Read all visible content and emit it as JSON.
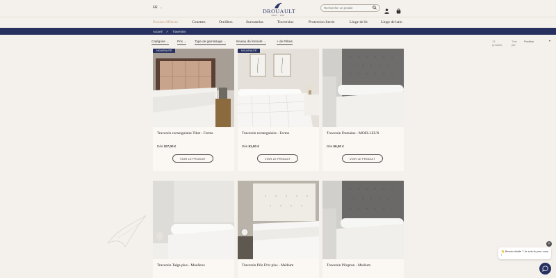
{
  "header": {
    "lang": "FR",
    "logo_name": "DROUAULT",
    "logo_tag": "PARIS · 1916",
    "search_placeholder": "Rechercher un produit"
  },
  "nav": {
    "items": [
      "Bonnes Affaires",
      "Couettes",
      "Oreillers",
      "Surmatelas",
      "Traversins",
      "Protection literie",
      "Linge de lit",
      "Linge de bain"
    ]
  },
  "breadcrumb": {
    "home": "Accueil",
    "sep": ">",
    "current": "Traversins"
  },
  "filters": {
    "items": [
      "Catégorie",
      "Prix",
      "Type de garnissage",
      "Niveau de fermeté",
      "+ de Filtres"
    ],
    "count": "13 produits",
    "sort_label": "Trier par",
    "sort_value": "Position"
  },
  "products": [
    {
      "title": "Traversin rectangulaire Tibet - Ferme",
      "price_prefix": "Dès",
      "price": "107,00 €",
      "button": "VOIR LE PRODUIT",
      "badge": "NOUVEAUTÉ"
    },
    {
      "title": "Traversin rectangulaire - Ferme",
      "price_prefix": "Dès",
      "price": "91,00 €",
      "button": "VOIR LE PRODUIT",
      "badge": "NOUVEAUTÉ"
    },
    {
      "title": "Traversin Domaine - MOELLEUX",
      "price_prefix": "Dès",
      "price": "59,00 €",
      "button": "VOIR LE PRODUIT",
      "badge": ""
    },
    {
      "title": "Traversin Talga plus - Moelleux",
      "price_prefix": "",
      "price": "",
      "button": "",
      "badge": ""
    },
    {
      "title": "Traversin Pilo D'or plus - Médium",
      "price_prefix": "",
      "price": "",
      "button": "",
      "badge": ""
    },
    {
      "title": "Traversin Pilopron - Medium",
      "price_prefix": "",
      "price": "",
      "button": "",
      "badge": ""
    }
  ],
  "chat": {
    "message": "👋 Besoin d'aide ? Je suis là pour vous !"
  },
  "colors": {
    "brand": "#27305f",
    "accent": "#c7a184",
    "background": "#f4f1ec"
  }
}
